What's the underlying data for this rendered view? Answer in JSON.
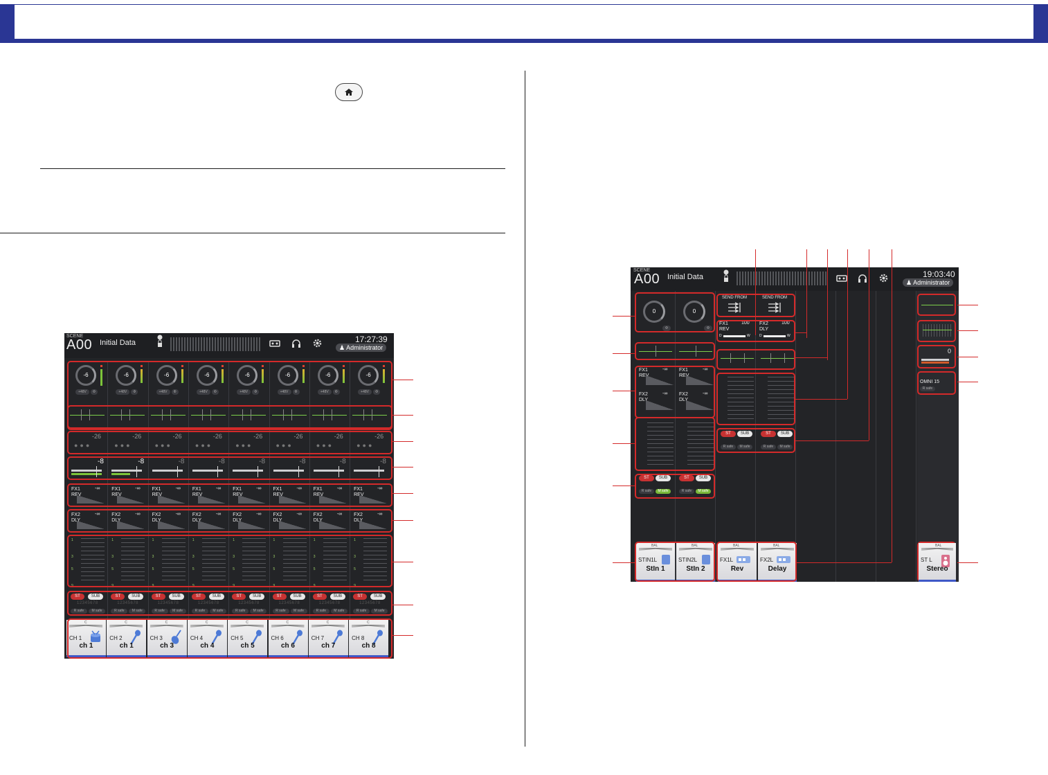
{
  "colors": {
    "header_blue": "#2a3694",
    "callout_red": "#d42a2a",
    "level_green": "#7cc43a",
    "st_red": "#c73232"
  },
  "icons": [
    "home-icon",
    "lock-icon",
    "usb-recorder-icon",
    "headphones-icon",
    "gear-icon",
    "user-icon",
    "microphone-icon",
    "drum-icon",
    "guitar-icon",
    "send-from-icon",
    "speaker-icon"
  ],
  "left_screen": {
    "scene_label": "SCENE",
    "scene_number": "A00",
    "scene_name": "Initial Data",
    "clock": "17:27:39",
    "user": "Administrator",
    "gain_values": [
      "-6",
      "-6",
      "-6",
      "-6",
      "-6",
      "-6",
      "-6",
      "-6"
    ],
    "phantom_label": "+48V",
    "phase_label": "Φ",
    "dynamics_values": [
      "-26",
      "-26",
      "-26",
      "-26",
      "-26",
      "-26",
      "-26",
      "-26"
    ],
    "fader_values": [
      "-8",
      "-8",
      "-8",
      "-8",
      "-8",
      "-8",
      "-8",
      "-8"
    ],
    "fader_levels": [
      1.0,
      0.6,
      0.0,
      0.0,
      0.0,
      0.0,
      0.0,
      0.0
    ],
    "fx1": {
      "line1": "FX1",
      "line2": "REV",
      "value": "-∞"
    },
    "fx2": {
      "line1": "FX2",
      "line2": "DLY",
      "value": "-∞"
    },
    "scale_labels": [
      "1",
      "3",
      "5",
      "9",
      "17"
    ],
    "st_label": "ST",
    "sub_label": "SUB",
    "bus_numbers": "12345678",
    "r_safe": "R safe",
    "m_safe": "M safe",
    "bal_label": "C",
    "channels": [
      {
        "id": "CH 1",
        "name": "ch 1",
        "icon": "drum-icon"
      },
      {
        "id": "CH 2",
        "name": "ch 1",
        "icon": "microphone-icon"
      },
      {
        "id": "CH 3",
        "name": "ch 3",
        "icon": "guitar-icon"
      },
      {
        "id": "CH 4",
        "name": "ch 4",
        "icon": "microphone-icon"
      },
      {
        "id": "CH 5",
        "name": "ch 5",
        "icon": "microphone-icon"
      },
      {
        "id": "CH 6",
        "name": "ch 6",
        "icon": "microphone-icon"
      },
      {
        "id": "CH 7",
        "name": "ch 7",
        "icon": "microphone-icon"
      },
      {
        "id": "CH 8",
        "name": "ch 8",
        "icon": "microphone-icon"
      }
    ]
  },
  "right_screen": {
    "scene_label": "SCENE",
    "scene_number": "A00",
    "scene_name": "Initial Data",
    "clock": "19:03:40",
    "user": "Administrator",
    "stin_gain": [
      "0",
      "0"
    ],
    "send_from": "SEND FROM",
    "fx_returns": [
      {
        "line1": "FX1",
        "line2": "REV",
        "value": "100",
        "d": "D",
        "w": "W"
      },
      {
        "line1": "FX2",
        "line2": "DLY",
        "value": "100",
        "d": "D",
        "w": "W"
      }
    ],
    "stin_fx": [
      {
        "line1": "FX1",
        "line2": "REV",
        "value": "-∞"
      },
      {
        "line1": "FX2",
        "line2": "DLY",
        "value": "-∞"
      }
    ],
    "stereo_fader_value": "0",
    "omni_label": "OMNI 15",
    "r_safe": "R safe",
    "m_safe": "M safe",
    "st_label": "ST",
    "sub_label": "SUB",
    "bal_label": "BAL",
    "name_cells": [
      {
        "id": "STIN1L",
        "name": "StIn 1"
      },
      {
        "id": "STIN2L",
        "name": "StIn 2"
      },
      {
        "id": "FX1L",
        "name": "Rev"
      },
      {
        "id": "FX2L",
        "name": "Delay"
      }
    ],
    "stereo_cell": {
      "id": "ST L",
      "name": "Stereo"
    }
  }
}
